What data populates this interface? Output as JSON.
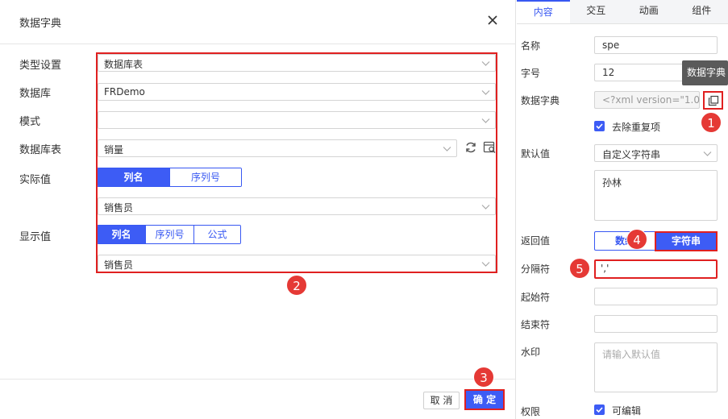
{
  "dialog": {
    "title": "数据字典",
    "rows": {
      "type_label": "类型设置",
      "type_value": "数据库表",
      "db_label": "数据库",
      "db_value": "FRDemo",
      "schema_label": "模式",
      "schema_value": "",
      "table_label": "数据库表",
      "table_value": "销量",
      "actual_label": "实际值",
      "actual_seg": [
        "列名",
        "序列号"
      ],
      "actual_value": "销售员",
      "display_label": "显示值",
      "display_seg": [
        "列名",
        "序列号",
        "公式"
      ],
      "display_value": "销售员"
    },
    "cancel_label": "取 消",
    "ok_label": "确 定"
  },
  "badges": [
    "1",
    "2",
    "3",
    "4",
    "5"
  ],
  "panel": {
    "tabs": [
      "内容",
      "交互",
      "动画",
      "组件"
    ],
    "name_label": "名称",
    "name_value": "spe",
    "font_label": "字号",
    "font_value": "12",
    "dict_label": "数据字典",
    "dict_value": "<?xml version=\"1.0\" e",
    "tooltip": "数据字典",
    "dedupe_label": "去除重复项",
    "default_label": "默认值",
    "default_type": "自定义字符串",
    "default_text": "孙林",
    "return_label": "返回值",
    "return_opts": [
      "数组",
      "字符串"
    ],
    "sep_label": "分隔符",
    "sep_value": "','",
    "start_label": "起始符",
    "end_label": "结束符",
    "watermark_label": "水印",
    "watermark_placeholder": "请输入默认值",
    "perm_label": "权限",
    "editable_label": "可编辑"
  },
  "colors": {
    "accent": "#3d5cf5",
    "highlight": "#e02020"
  }
}
